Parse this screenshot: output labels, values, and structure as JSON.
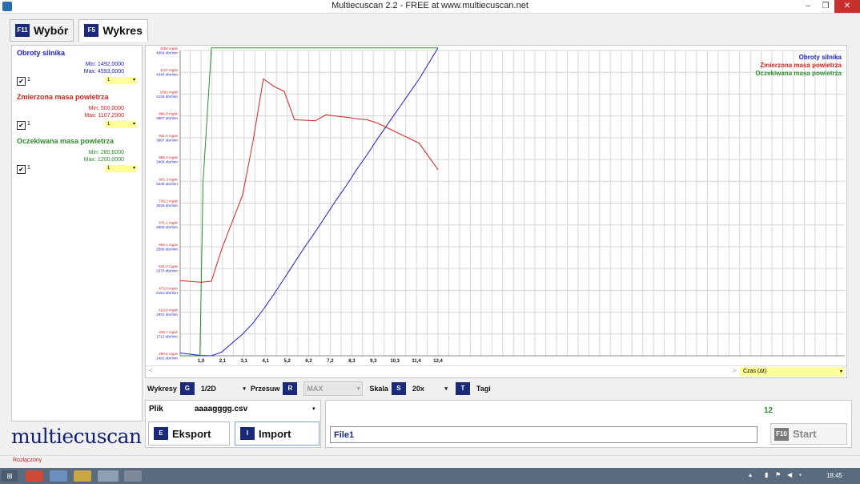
{
  "window": {
    "title": "Multiecuscan 2.2 - FREE at www.multiecuscan.net",
    "min": "–",
    "restore": "❐",
    "close": "✕"
  },
  "tabs": [
    {
      "key": "F11",
      "label": "Wybór"
    },
    {
      "key": "F5",
      "label": "Wykres"
    }
  ],
  "signals": [
    {
      "name": "Obroty silnika",
      "min": "Min: 1492,0000",
      "max": "Max: 4593,0000",
      "checked": "✔",
      "num": "1",
      "select": "1",
      "color": "#1c1cc8"
    },
    {
      "name": "Zmierzona masa powietrza",
      "min": "Min: 500,0000",
      "max": "Max: 1107,2000",
      "checked": "✔",
      "num": "1",
      "select": "1",
      "color": "#d42020"
    },
    {
      "name": "Oczekiwana masa powietrza",
      "min": "Min: 280,6000",
      "max": "Max: 1200,0000",
      "checked": "✔",
      "num": "1",
      "select": "1",
      "color": "#2e8b2e"
    }
  ],
  "legend": [
    "Obroty silnika",
    "Zmierzona masa powietrza",
    "Oczekiwana masa powietrza"
  ],
  "chart_data": {
    "type": "line",
    "title": "",
    "xlabel": "",
    "ylabel": "",
    "x_ticks": [
      "1,0",
      "2,1",
      "3,1",
      "4,1",
      "5,2",
      "6,2",
      "7,2",
      "8,3",
      "9,3",
      "10,3",
      "11,4",
      "12,4"
    ],
    "y_ticks_mass": [
      "1192 mg/w",
      "1127 mg/w",
      "1062 mg/w",
      "996,8 mg/w",
      "931,5 mg/w",
      "866,4 mg/w",
      "801,3 mg/w",
      "736,2 mg/w",
      "671,1 mg/w",
      "606,1 mg/w",
      "541,0 mg/w",
      "475,9 mg/w",
      "410,8 mg/w",
      "345,7 mg/w",
      "280,6 mg/w"
    ],
    "y_ticks_rpm": [
      "4566 obr/min",
      "4346 obr/min",
      "4126 obr/min",
      "3907 obr/min",
      "3687 obr/min",
      "3468 obr/min",
      "3248 obr/min",
      "3029 obr/min",
      "2809 obr/min",
      "2590 obr/min",
      "2370 obr/min",
      "2151 obr/min",
      "1931 obr/min",
      "1712 obr/min",
      "1492 obr/min"
    ],
    "xlim": [
      0,
      12.4
    ],
    "ylim_mass": [
      280.6,
      1192
    ],
    "ylim_rpm": [
      1492,
      4566
    ],
    "grid": true,
    "legend_position": "top-right",
    "series": [
      {
        "name": "Obroty silnika",
        "axis": "rpm",
        "color": "#1c1cc8",
        "x": [
          0,
          1.0,
          1.5,
          2.0,
          2.5,
          3.0,
          3.5,
          4.0,
          4.5,
          5.0,
          5.5,
          6.0,
          6.5,
          7.0,
          7.5,
          8.0,
          8.5,
          9.0,
          9.5,
          10.0,
          10.5,
          11.0,
          11.5,
          12.4
        ],
        "y": [
          1520,
          1495,
          1492,
          1530,
          1620,
          1710,
          1820,
          1960,
          2110,
          2270,
          2430,
          2590,
          2740,
          2900,
          3060,
          3210,
          3370,
          3520,
          3680,
          3830,
          3980,
          4130,
          4280,
          4593
        ]
      },
      {
        "name": "Zmierzona masa powietrza",
        "axis": "mass",
        "color": "#d42020",
        "x": [
          0,
          1.0,
          1.5,
          2.0,
          2.5,
          3.0,
          3.5,
          4.0,
          4.5,
          5.0,
          5.5,
          6.0,
          6.5,
          7.0,
          7.5,
          8.0,
          8.5,
          9.0,
          9.5,
          10.0,
          10.5,
          11.0,
          11.5,
          12.4
        ],
        "y": [
          505,
          500,
          503,
          600,
          680,
          760,
          920,
          1107,
          1085,
          1070,
          985,
          984,
          982,
          1000,
          996,
          993,
          988,
          985,
          975,
          960,
          945,
          930,
          915,
          836
        ]
      },
      {
        "name": "Oczekiwana masa powietrza",
        "axis": "mass",
        "color": "#2e8b2e",
        "x": [
          0,
          0.95,
          1.1,
          1.5,
          12.4
        ],
        "y": [
          280.6,
          280.6,
          800,
          1200,
          1200
        ]
      }
    ]
  },
  "scroll": {
    "czas": "Czas (Δt)",
    "arrow": "▾",
    "left": "<",
    "right": ">"
  },
  "toolbar": {
    "wykresy": "Wykresy",
    "wykresy_key": "G",
    "wykresy_val": "1/2D",
    "przesuw": "Przesuw",
    "przesuw_key": "R",
    "przesuw_val": "MAX",
    "skala": "Skala",
    "skala_key": "S",
    "skala_val": "20x",
    "tagi_key": "T",
    "tagi": "Tagi",
    "arrow": "▾"
  },
  "file": {
    "label": "Plik",
    "name": "aaaagggg.csv",
    "arrow": "▾"
  },
  "buttons": {
    "eksport_key": "E",
    "eksport": "Eksport",
    "import_key": "I",
    "import": "Import",
    "start_key": "F10",
    "start": "Start"
  },
  "right": {
    "count": "12",
    "file1": "File1"
  },
  "logo": "multiecuscan",
  "status": "Rozłączony",
  "clock": "18:45"
}
